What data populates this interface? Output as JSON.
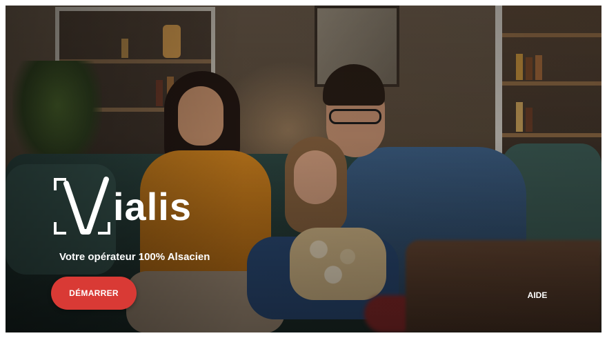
{
  "brand": {
    "logo_text": "ialis",
    "logo_initial": "V",
    "tagline": "Votre opérateur 100% Alsacien"
  },
  "actions": {
    "start_label": "DÉMARRER",
    "help_label": "AIDE"
  },
  "colors": {
    "accent": "#d93a35",
    "text": "#ffffff"
  }
}
